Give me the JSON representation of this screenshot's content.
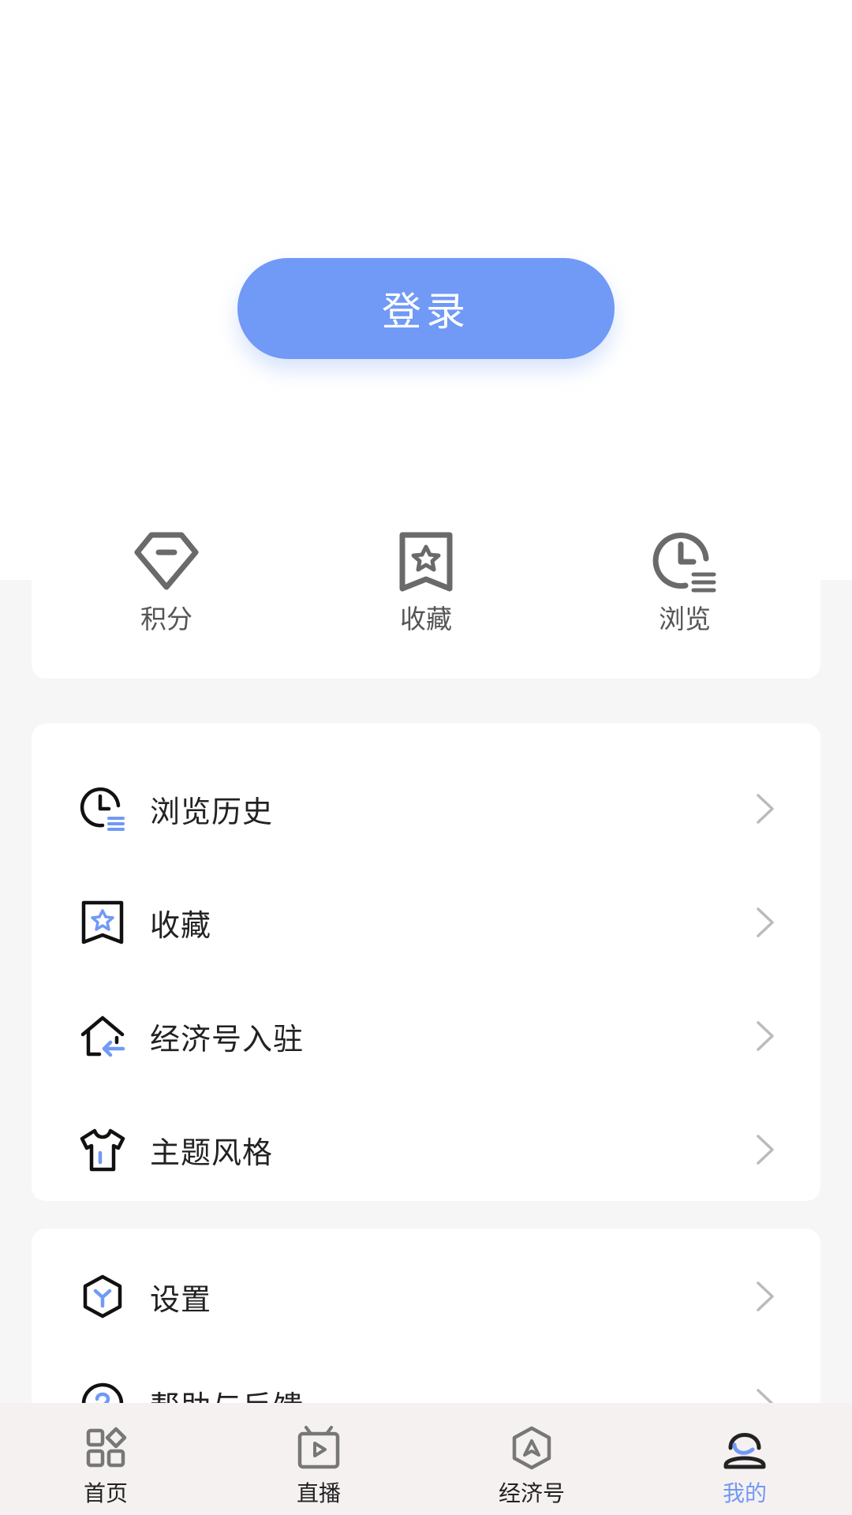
{
  "login": {
    "label": "登录"
  },
  "stats": [
    {
      "label": "积分",
      "icon": "diamond-icon"
    },
    {
      "label": "收藏",
      "icon": "bookmark-star-icon"
    },
    {
      "label": "浏览",
      "icon": "clock-list-icon"
    }
  ],
  "menu_group1": [
    {
      "label": "浏览历史",
      "icon": "history-clock-icon"
    },
    {
      "label": "收藏",
      "icon": "bookmark-star-icon"
    },
    {
      "label": "经济号入驻",
      "icon": "house-arrow-icon"
    },
    {
      "label": "主题风格",
      "icon": "tshirt-icon"
    }
  ],
  "menu_group2": [
    {
      "label": "设置",
      "icon": "hexagon-settings-icon"
    },
    {
      "label": "帮助与反馈",
      "icon": "help-icon"
    }
  ],
  "tabs": [
    {
      "label": "首页",
      "icon": "grid-home-icon"
    },
    {
      "label": "直播",
      "icon": "tv-play-icon"
    },
    {
      "label": "经济号",
      "icon": "hexagon-arrow-icon"
    },
    {
      "label": "我的",
      "icon": "user-icon",
      "active": true
    }
  ],
  "colors": {
    "accent": "#7199f6",
    "background": "#f6f6f6",
    "card": "#ffffff",
    "tabbar": "#f6f1f1"
  }
}
